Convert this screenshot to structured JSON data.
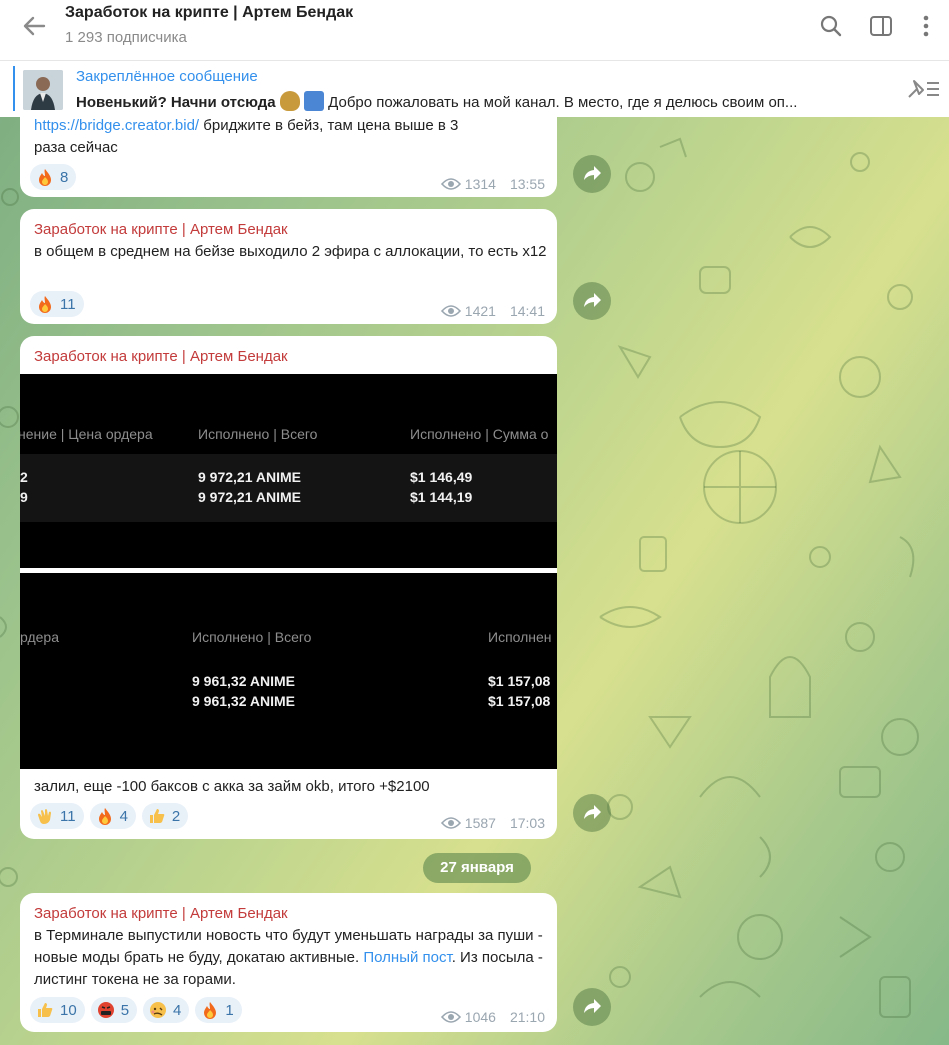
{
  "header": {
    "title": "Заработок на крипте | Артем Бендак",
    "subscribers": "1 293 подписчика"
  },
  "pinned": {
    "title": "Закреплённое сообщение",
    "bold_text": "Новенький? Начни отсюда",
    "rest_text": "Добро пожаловать на мой канал. В место, где я делюсь своим оп..."
  },
  "messages": [
    {
      "link": "https://bridge.creator.bid/",
      "text_after_link": " бриджите в бейз, там цена выше в 3",
      "text_line2": "раза сейчас",
      "reactions": [
        {
          "icon": "fire-icon",
          "count": "8"
        }
      ],
      "views": "1314",
      "time": "13:55"
    },
    {
      "author": "Заработок на крипте | Артем Бендак",
      "text": "в общем в среднем на бейзе выходило 2 эфира с аллокации, то есть х12",
      "reactions": [
        {
          "icon": "fire-icon",
          "count": "11"
        }
      ],
      "views": "1421",
      "time": "14:41"
    },
    {
      "author": "Заработок на крипте | Артем Бендак",
      "screenshot1": {
        "headers": [
          "нение | Цена ордера",
          "Исполнено | Всего",
          "Исполнено | Сумма о"
        ],
        "rows": [
          [
            "2",
            "9 972,21 ANIME",
            "$1 146,49"
          ],
          [
            "9",
            "9 972,21 ANIME",
            "$1 144,19"
          ]
        ]
      },
      "screenshot2": {
        "headers": [
          "рдера",
          "Исполнено | Всего",
          "Исполнен"
        ],
        "rows": [
          [
            "",
            "9 961,32 ANIME",
            "$1 157,08"
          ],
          [
            "",
            "9 961,32 ANIME",
            "$1 157,08"
          ]
        ]
      },
      "text": "залил, еще -100 баксов с акка за займ okb, итого +$2100",
      "reactions": [
        {
          "icon": "clap-icon",
          "count": "11"
        },
        {
          "icon": "fire-icon",
          "count": "4"
        },
        {
          "icon": "thumbs-up-icon",
          "count": "2"
        }
      ],
      "views": "1587",
      "time": "17:03"
    },
    {
      "author": "Заработок на крипте | Артем Бендак",
      "text_before_link": "в Терминале выпустили новость что будут уменьшать награды за пуши - новые моды брать не буду, докатаю активные. ",
      "link": "Полный пост",
      "text_after_link": ". Из посыла - листинг токена не за горами.",
      "reactions": [
        {
          "icon": "thumbs-up-icon",
          "count": "10"
        },
        {
          "icon": "swearing-face-icon",
          "count": "5"
        },
        {
          "icon": "woozy-face-icon",
          "count": "4"
        },
        {
          "icon": "fire-icon",
          "count": "1"
        }
      ],
      "views": "1046",
      "time": "21:10"
    }
  ],
  "date_separator": "27 января",
  "colors": {
    "accent": "#3390ec",
    "author": "#c33b3b",
    "reaction_bg": "#e8f0f8",
    "reaction_text": "#3a74a8"
  }
}
